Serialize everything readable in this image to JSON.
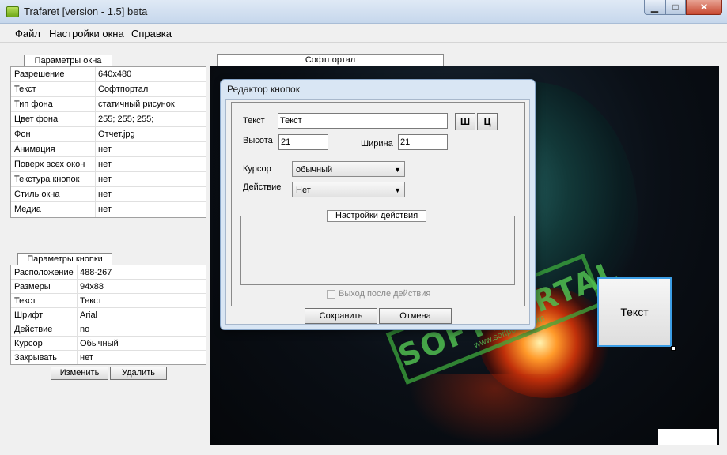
{
  "window": {
    "title": "Trafaret [version - 1.5] beta",
    "min_glyph": "▁",
    "max_glyph": "□",
    "close_glyph": "✕"
  },
  "menu": [
    "Файл",
    "Настройки окна",
    "Справка"
  ],
  "window_params": {
    "caption": "Параметры окна",
    "rows": [
      {
        "key": "Разрешение",
        "value": "640x480"
      },
      {
        "key": "Текст",
        "value": "Софтпортал"
      },
      {
        "key": "Тип фона",
        "value": "статичный рисунок"
      },
      {
        "key": "Цвет фона",
        "value": "255; 255; 255;"
      },
      {
        "key": "Фон",
        "value": "Отчет.jpg"
      },
      {
        "key": "Анимация",
        "value": "нет"
      },
      {
        "key": "Поверх всех окон",
        "value": "нет"
      },
      {
        "key": "Текстура кнопок",
        "value": "нет"
      },
      {
        "key": "Стиль окна",
        "value": "нет"
      },
      {
        "key": "Медиа",
        "value": "нет"
      }
    ]
  },
  "button_params": {
    "caption": "Параметры кнопки",
    "rows": [
      {
        "key": "Расположение",
        "value": "488-267"
      },
      {
        "key": "Размеры",
        "value": "94x88"
      },
      {
        "key": "Текст",
        "value": "Текст"
      },
      {
        "key": "Шрифт",
        "value": "Arial"
      },
      {
        "key": "Действие",
        "value": "no"
      },
      {
        "key": "Курсор",
        "value": "Обычный"
      },
      {
        "key": "Закрывать",
        "value": "нет"
      }
    ],
    "edit_label": "Изменить",
    "delete_label": "Удалить"
  },
  "preview": {
    "caption": "Софтпортал",
    "button_text": "Текст",
    "watermark": "SOFTPORTAL",
    "watermark_sub": "www.softportal.com",
    "watermark_tm": "™"
  },
  "dialog": {
    "title": "Редактор кнопок",
    "text_label": "Текст",
    "text_value": "Текст",
    "bold_label": "Ш",
    "color_label": "Ц",
    "height_label": "Высота",
    "height_value": "21",
    "width_label": "Ширина",
    "width_value": "21",
    "cursor_label": "Курсор",
    "cursor_value": "обычный",
    "action_label": "Действие",
    "action_value": "Нет",
    "action_settings_label": "Настройки действия",
    "exit_after_label": "Выход после действия",
    "save_label": "Сохранить",
    "cancel_label": "Отмена"
  }
}
